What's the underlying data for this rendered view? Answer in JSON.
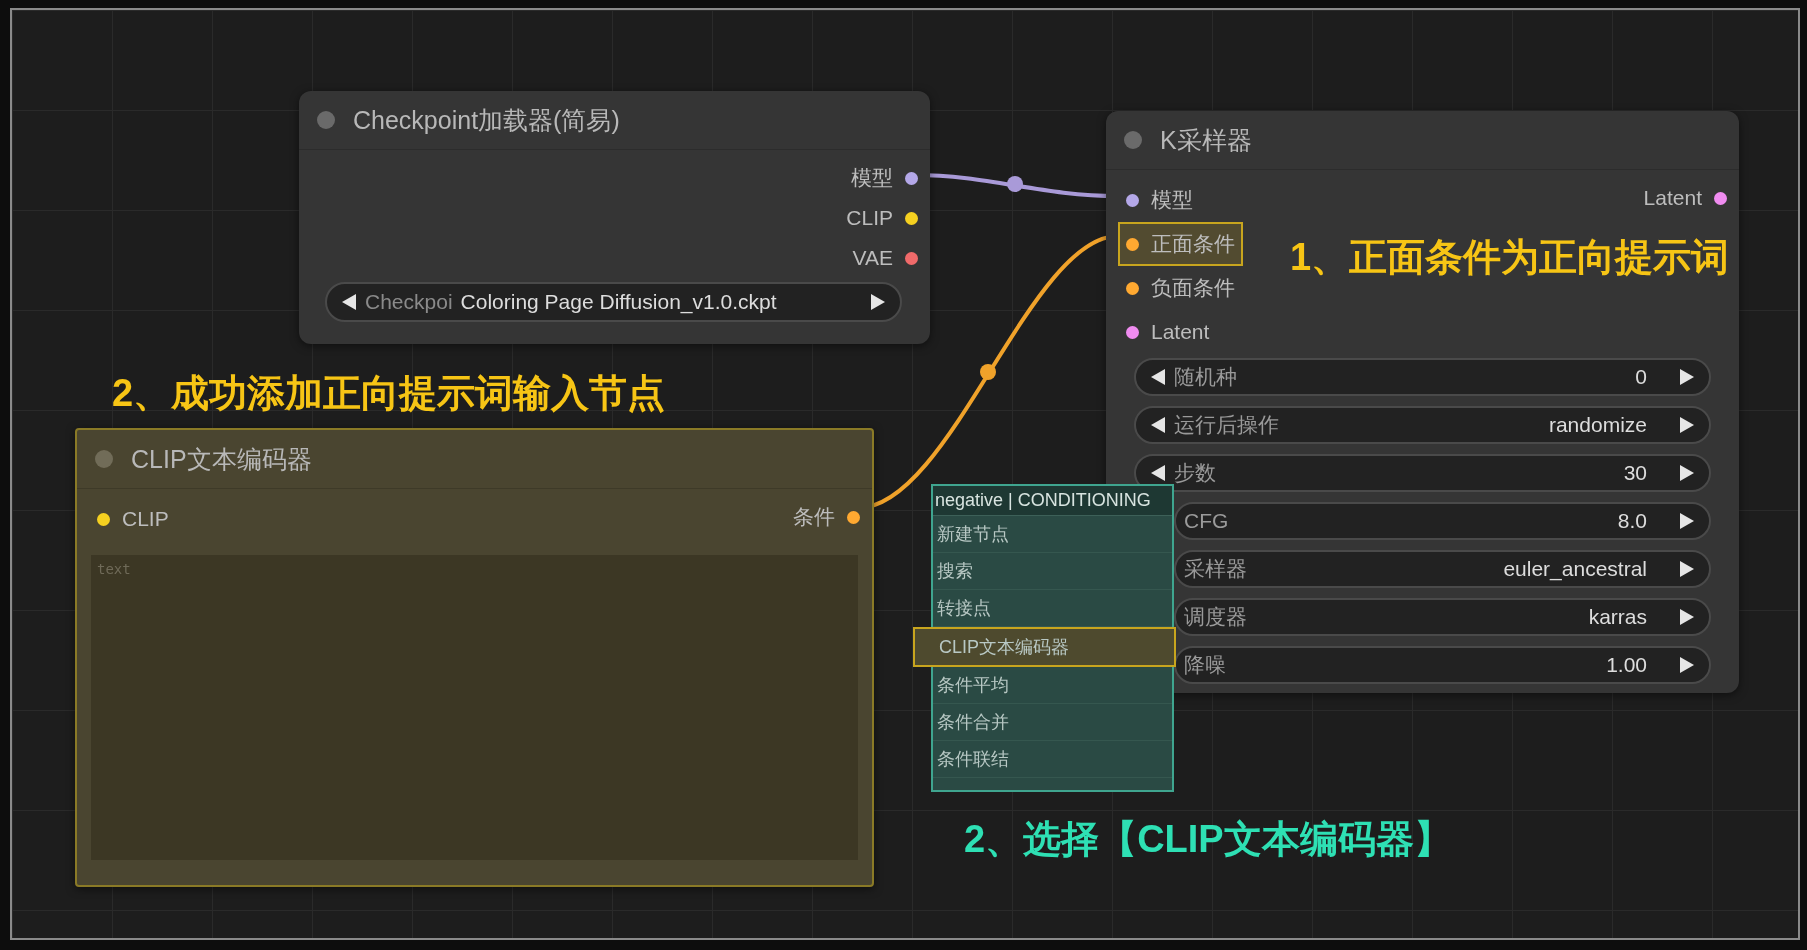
{
  "checkpoint_node": {
    "title": "Checkpoint加载器(简易)",
    "outputs": [
      {
        "label": "模型",
        "color": "#b4a8e8"
      },
      {
        "label": "CLIP",
        "color": "#f5d020"
      },
      {
        "label": "VAE",
        "color": "#f06a6a"
      }
    ],
    "widget": {
      "label": "Checkpoi",
      "value": "Coloring Page Diffusion_v1.0.ckpt"
    }
  },
  "sampler_node": {
    "title": "K采样器",
    "inputs": [
      {
        "label": "模型",
        "color": "#b4a8e8",
        "highlighted": false
      },
      {
        "label": "正面条件",
        "color": "#ffa931",
        "highlighted": true
      },
      {
        "label": "负面条件",
        "color": "#ffa931",
        "highlighted": false
      },
      {
        "label": "Latent",
        "color": "#f08cf0",
        "highlighted": false
      }
    ],
    "outputs": [
      {
        "label": "Latent",
        "color": "#f08cf0"
      }
    ],
    "widgets": [
      {
        "label": "随机种",
        "value": "0"
      },
      {
        "label": "运行后操作",
        "value": "randomize"
      },
      {
        "label": "步数",
        "value": "30"
      },
      {
        "label": "CFG",
        "value": "8.0"
      },
      {
        "label": "采样器",
        "value": "euler_ancestral"
      },
      {
        "label": "调度器",
        "value": "karras"
      },
      {
        "label": "降噪",
        "value": "1.00"
      }
    ]
  },
  "clip_node": {
    "title": "CLIP文本编码器",
    "inputs": [
      {
        "label": "CLIP",
        "color": "#f5d020"
      }
    ],
    "outputs": [
      {
        "label": "条件",
        "color": "#ffa931"
      }
    ],
    "text_field": {
      "placeholder": "text"
    }
  },
  "context_menu": {
    "header": "negative | CONDITIONING",
    "items": [
      {
        "label": "新建节点",
        "selected": false
      },
      {
        "label": "搜索",
        "selected": false
      },
      {
        "label": "转接点",
        "selected": false
      },
      {
        "label": "CLIP文本编码器",
        "selected": true
      },
      {
        "label": "条件平均",
        "selected": false
      },
      {
        "label": "条件合并",
        "selected": false
      },
      {
        "label": "条件联结",
        "selected": false
      }
    ]
  },
  "annotations": [
    {
      "text": "1、正面条件为正向提示词",
      "color": "#f7c515"
    },
    {
      "text": "2、成功添加正向提示词输入节点",
      "color": "#f7c515"
    },
    {
      "text": "2、选择【CLIP文本编码器】",
      "color": "#2ee0b4"
    }
  ]
}
